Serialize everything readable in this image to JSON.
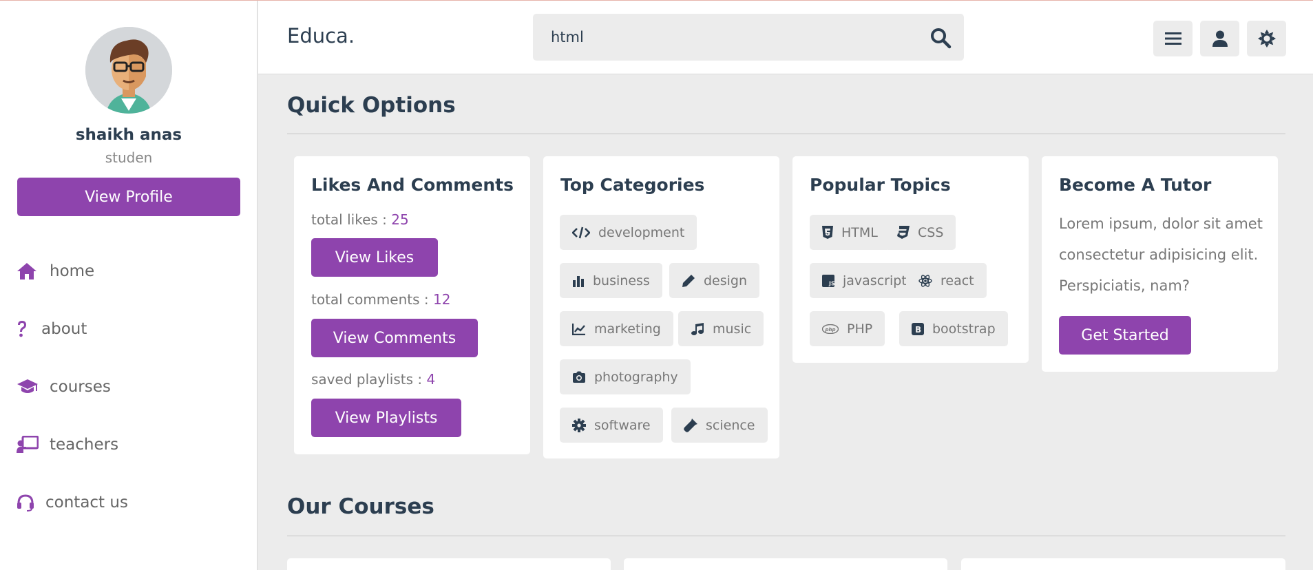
{
  "profile": {
    "name": "shaikh anas",
    "role": "studen",
    "view_profile_label": "View Profile"
  },
  "nav": [
    {
      "label": "home",
      "icon": "home-icon"
    },
    {
      "label": "about",
      "icon": "question-icon"
    },
    {
      "label": "courses",
      "icon": "graduation-cap-icon"
    },
    {
      "label": "teachers",
      "icon": "chalkboard-teacher-icon"
    },
    {
      "label": "contact us",
      "icon": "headset-icon"
    }
  ],
  "header": {
    "logo": "Educa.",
    "search_value": "html",
    "buttons": [
      "menu-icon",
      "user-icon",
      "sun-icon"
    ]
  },
  "quick_options": {
    "title": "Quick Options",
    "likes_card": {
      "title": "Likes And Comments",
      "likes_label": "total likes : ",
      "likes_value": "25",
      "likes_button": "View Likes",
      "comments_label": "total comments : ",
      "comments_value": "12",
      "comments_button": "View Comments",
      "playlists_label": "saved playlists : ",
      "playlists_value": "4",
      "playlists_button": "View Playlists"
    },
    "categories_card": {
      "title": "Top Categories",
      "tags": [
        "development",
        "business",
        "design",
        "marketing",
        "music",
        "photography",
        "software",
        "science"
      ]
    },
    "topics_card": {
      "title": "Popular Topics",
      "tags": [
        "HTML",
        "CSS",
        "javascript",
        "react",
        "PHP",
        "bootstrap"
      ]
    },
    "tutor_card": {
      "title": "Become A Tutor",
      "text": "Lorem ipsum, dolor sit amet consectetur adipisicing elit. Perspiciatis, nam?",
      "button": "Get Started"
    }
  },
  "courses": {
    "title": "Our Courses"
  },
  "colors": {
    "accent": "#8e44ad",
    "text_dark": "#2c3e50",
    "background": "#ececec"
  }
}
